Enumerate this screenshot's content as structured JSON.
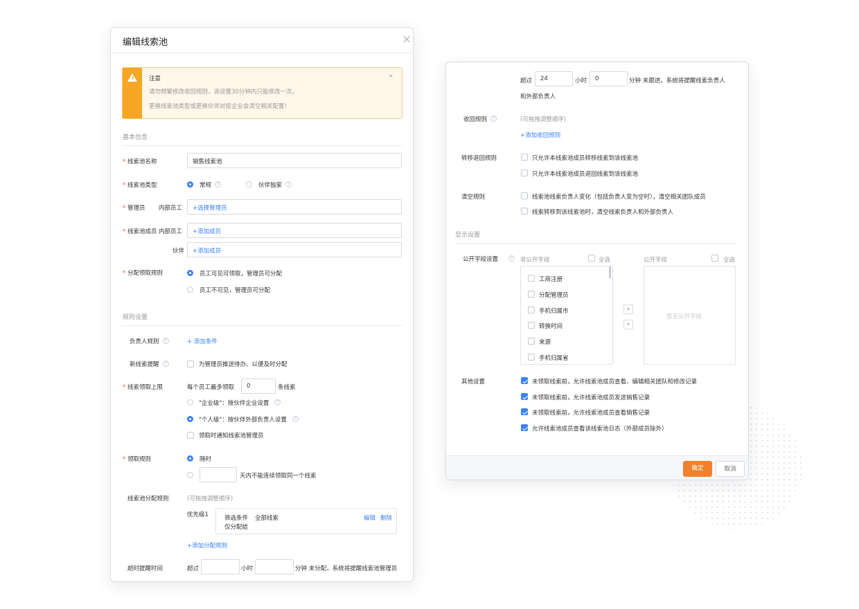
{
  "left": {
    "title": "编辑线索池",
    "alert": {
      "title": "注意",
      "line1": "请勿频繁修改收回规则，该设置30分钟内只能修改一次。",
      "line2": "更换线索池类型或更换伙伴对接企业会清空相关配置！"
    },
    "basic_section": "基本信息",
    "pool_name_label": "线索池名称",
    "pool_name_value": "销售线索池",
    "pool_type_label": "线索池类型",
    "pool_type_options": [
      "常规",
      "伙伴独家"
    ],
    "admin_label": "管理员",
    "admin_sub": "内部员工",
    "admin_add": "+选择管理员",
    "members_label": "线索池成员",
    "members_sub": "内部员工",
    "members_add": "+添加成员",
    "partner_label": "伙伴",
    "partner_add": "+添加成员",
    "assign_label": "分配领取规则",
    "assign_options": [
      "员工可见可领取，管理员可分配",
      "员工不可见，管理员可分配"
    ],
    "rule_section": "规则设置",
    "owner_rule_label": "负责人规则",
    "owner_rule_add": "+ 添加条件",
    "new_remind_label": "新线索提醒",
    "new_remind_option": "为管理员推送待办、以便及时分配",
    "limit_label": "线索领取上限",
    "limit_prefix": "每个员工最多领取",
    "limit_value": "0",
    "limit_suffix": "条线索",
    "limit_options": [
      "\"企业级\"：按伙伴企业设置",
      "\"个人级\"：按伙伴外部负责人设置"
    ],
    "limit_notify": "领取时通知线索池管理员",
    "claim_rule_label": "领取规则",
    "claim_opt1": "随时",
    "claim_opt2_suffix": "天内不能连续领取同一个线索",
    "dist_rule_label": "线索池分配规则",
    "dist_hint": "(可拖拽调整顺序)",
    "priority": "优先级1",
    "filter_label": "筛选条件",
    "filter_value": "全部线索",
    "only_assign": "仅分配给",
    "edit": "编辑",
    "delete": "删除",
    "add_dist": "+添加分配规则",
    "timeout_label": "超时提醒时间",
    "timeout_over": "超过",
    "timeout_hour": "小时",
    "timeout_tail": "分钟 未分配，系统将提醒线索池管理员"
  },
  "right": {
    "over": "超过",
    "hours_value": "24",
    "hour_unit": "小时",
    "minutes_value": "0",
    "minute_tail": "分钟 未跟进，系统将提醒线索负责人",
    "minute_tail2": "和外部负责人",
    "recall_label": "收回规则",
    "recall_hint": "(可拖拽调整顺序)",
    "recall_add": "+添加收回规则",
    "transfer_label": "转移退回规则",
    "transfer_opts": [
      "只允许本线索池成员转移线索到该线索池",
      "只允许本线索池成员退回线索到该线索池"
    ],
    "clear_label": "清空规则",
    "clear_opts": [
      "线索池线索负责人变化（包括负责人变为空时），清空相关团队成员",
      "线索转移到该线索池时，清空线索负责人和外部负责人"
    ],
    "display_section": "显示设置",
    "public_label": "公开字段设置",
    "nonpublic_title": "非公开字段",
    "public_title": "公开字段",
    "select_all": "全选",
    "fields": [
      "工商注册",
      "分配管理员",
      "手机归属市",
      "转换时间",
      "来源",
      "手机归属省"
    ],
    "empty_public": "暂无公开字段",
    "other_label": "其他设置",
    "other_opts": [
      "未领取线索前，允许线索池成员查看、编辑相关团队和修改记录",
      "未领取线索前，允许线索池成员发送销售记录",
      "未领取线索前，允许线索池成员查看销售记录",
      "允许线索池成员查看该线索池日志（外部成员除外）"
    ],
    "confirm": "确定",
    "cancel": "取消"
  },
  "colors": {
    "accent": "#3b82f6",
    "warning": "#f5a623",
    "confirm": "#f0822d"
  }
}
